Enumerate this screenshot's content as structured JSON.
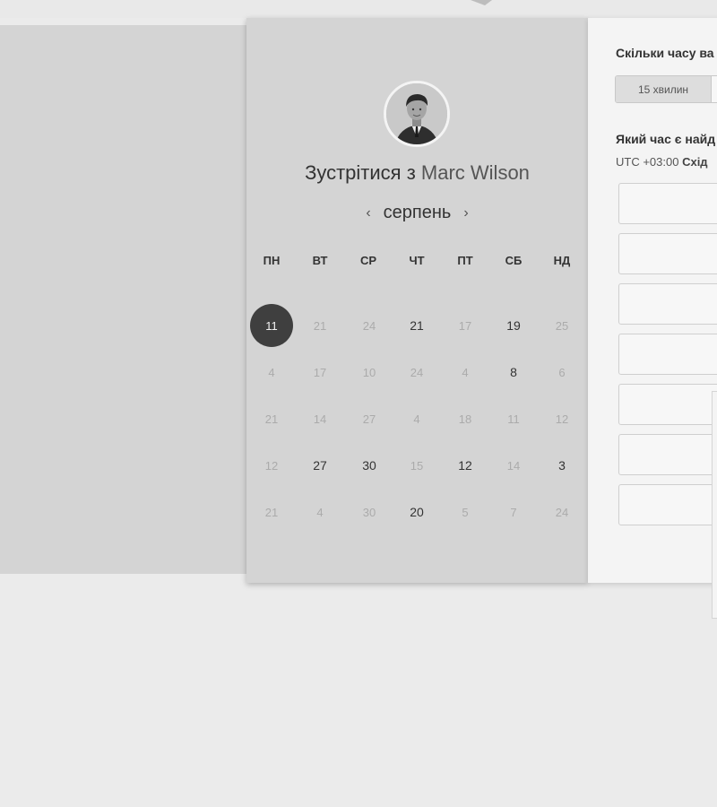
{
  "scheduler": {
    "title_prefix": "Зустрітися з",
    "host_name": "Marc Wilson",
    "month": "серпень",
    "prev_icon": "chevron-left-icon",
    "next_icon": "chevron-right-icon",
    "weekdays": [
      "ПН",
      "ВТ",
      "СР",
      "ЧТ",
      "ПТ",
      "СБ",
      "НД"
    ],
    "weeks": [
      [
        {
          "d": "11",
          "state": "selected"
        },
        {
          "d": "21",
          "state": "unavailable"
        },
        {
          "d": "24",
          "state": "unavailable"
        },
        {
          "d": "21",
          "state": "available"
        },
        {
          "d": "17",
          "state": "unavailable"
        },
        {
          "d": "19",
          "state": "available"
        },
        {
          "d": "25",
          "state": "unavailable"
        }
      ],
      [
        {
          "d": "4",
          "state": "unavailable"
        },
        {
          "d": "17",
          "state": "unavailable"
        },
        {
          "d": "10",
          "state": "unavailable"
        },
        {
          "d": "24",
          "state": "unavailable"
        },
        {
          "d": "4",
          "state": "unavailable"
        },
        {
          "d": "8",
          "state": "available"
        },
        {
          "d": "6",
          "state": "unavailable"
        }
      ],
      [
        {
          "d": "21",
          "state": "unavailable"
        },
        {
          "d": "14",
          "state": "unavailable"
        },
        {
          "d": "27",
          "state": "unavailable"
        },
        {
          "d": "4",
          "state": "unavailable"
        },
        {
          "d": "18",
          "state": "unavailable"
        },
        {
          "d": "11",
          "state": "unavailable"
        },
        {
          "d": "12",
          "state": "unavailable"
        }
      ],
      [
        {
          "d": "12",
          "state": "unavailable"
        },
        {
          "d": "27",
          "state": "available"
        },
        {
          "d": "30",
          "state": "available"
        },
        {
          "d": "15",
          "state": "unavailable"
        },
        {
          "d": "12",
          "state": "available"
        },
        {
          "d": "14",
          "state": "unavailable"
        },
        {
          "d": "3",
          "state": "available"
        }
      ],
      [
        {
          "d": "21",
          "state": "unavailable"
        },
        {
          "d": "4",
          "state": "unavailable"
        },
        {
          "d": "30",
          "state": "unavailable"
        },
        {
          "d": "20",
          "state": "available"
        },
        {
          "d": "5",
          "state": "unavailable"
        },
        {
          "d": "7",
          "state": "unavailable"
        },
        {
          "d": "24",
          "state": "unavailable"
        }
      ]
    ]
  },
  "booking": {
    "duration_question": "Скільки часу ва",
    "duration_option_1": "15 хвилин",
    "time_question": "Який час є найд",
    "timezone_offset": "UTC +03:00",
    "timezone_name": "Схід",
    "slot_count": 7
  },
  "colors": {
    "selected_day": "#3f3f3f",
    "panel_bg": "#d4d4d4",
    "right_panel_bg": "#f4f4f4"
  }
}
